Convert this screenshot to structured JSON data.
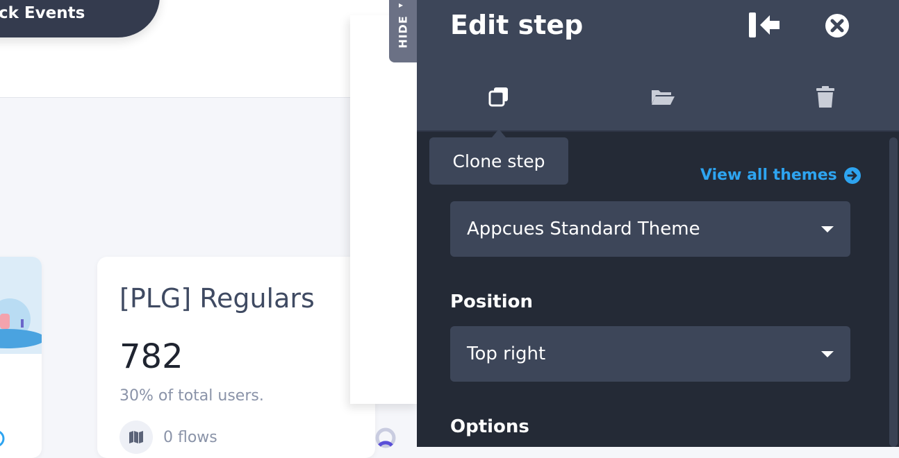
{
  "header_pill": {
    "label": "ck Events"
  },
  "segment_card": {
    "title": "[PLG] Regulars",
    "count": "782",
    "percent_text": "30% of total users.",
    "flows_text": "0 flows"
  },
  "hide_tab": {
    "label": "HIDE"
  },
  "edit_panel": {
    "title": "Edit step",
    "header_icons": [
      "collapse-left-icon",
      "close-circle-icon"
    ],
    "actions": [
      {
        "name": "clone-step",
        "icon": "copy-icon",
        "tooltip": "Clone step"
      },
      {
        "name": "move-step",
        "icon": "folder-open-icon"
      },
      {
        "name": "delete-step",
        "icon": "trash-icon"
      }
    ],
    "tooltip": "Clone step",
    "view_all_themes": "View all themes",
    "theme_select": {
      "value": "Appcues Standard Theme"
    },
    "position_label": "Position",
    "position_select": {
      "value": "Top right"
    },
    "options_label": "Options"
  },
  "colors": {
    "panel_bg": "#242a36",
    "panel_header": "#3d4659",
    "accent_link": "#2ea4f0",
    "pill_bg": "#343b4e"
  }
}
